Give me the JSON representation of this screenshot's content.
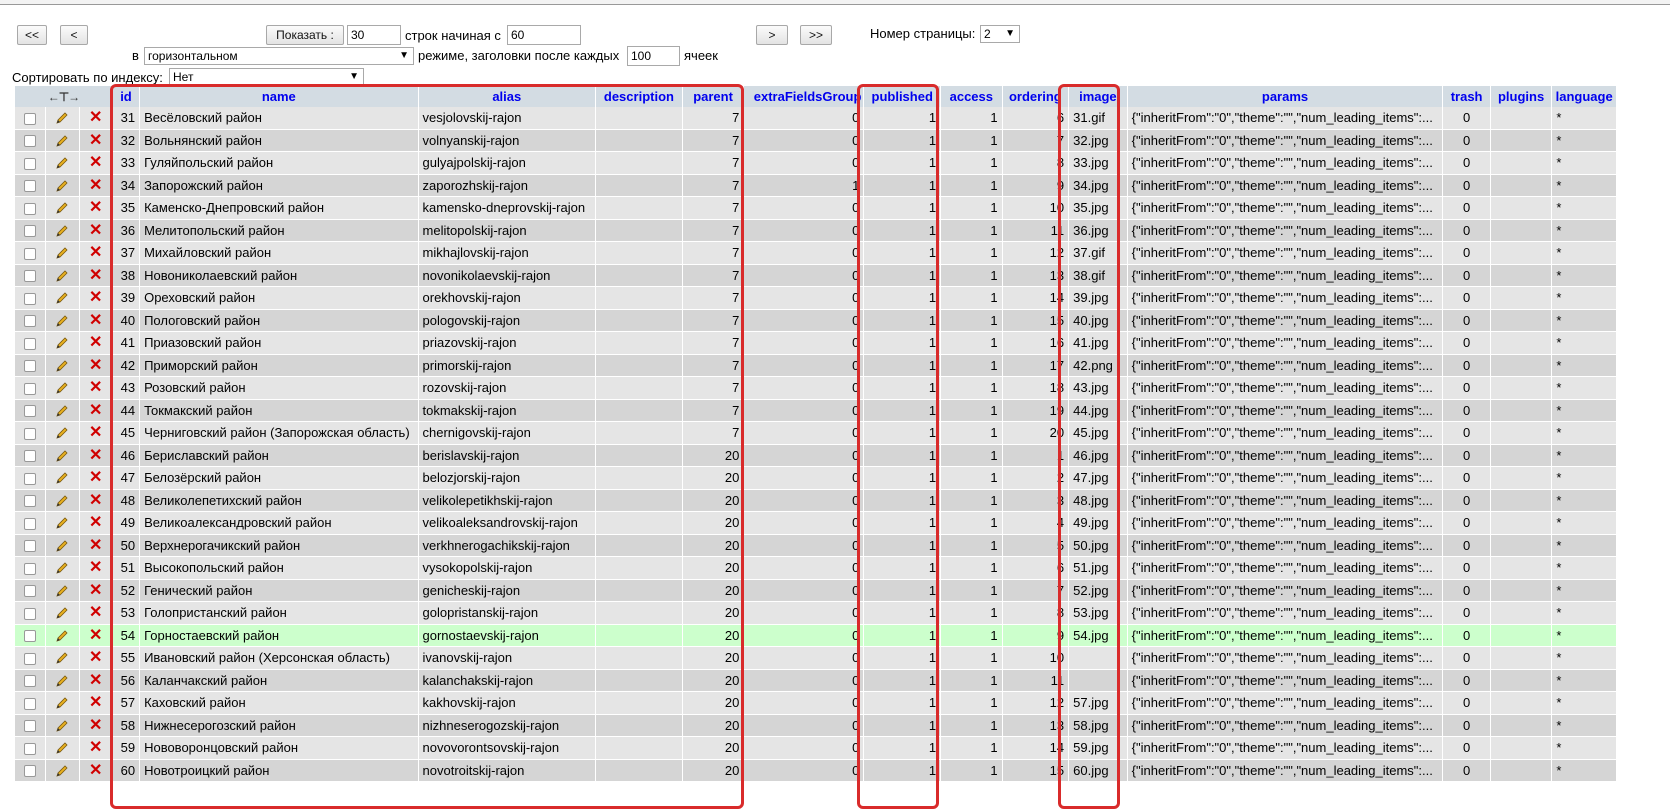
{
  "nav": {
    "first": "<<",
    "prev": "<",
    "show": "Показать :",
    "rows_value": "30",
    "rows_label": "строк начиная с",
    "start_value": "60",
    "next": ">",
    "last": ">>",
    "page_label": "Номер страницы:",
    "page_value": "2"
  },
  "mode": {
    "in_label": "в",
    "mode_value": "горизонтальном",
    "mode_label": "режиме, заголовки после каждых",
    "cells_value": "100",
    "cells_label": "ячеек"
  },
  "sort": {
    "label": "Сортировать по индексу:",
    "value": "Нет"
  },
  "columns": [
    "id",
    "name",
    "alias",
    "description",
    "parent",
    "extraFieldsGroup",
    "published",
    "access",
    "ordering",
    "image",
    "params",
    "trash",
    "plugins",
    "language"
  ],
  "params_text": "{\"inheritFrom\":\"0\",\"theme\":\"\",\"num_leading_items\":...",
  "rows": [
    {
      "id": "31",
      "name": "Весёловский район",
      "alias": "vesjolovskij-rajon",
      "parent": "7",
      "efg": "0",
      "published": "1",
      "access": "1",
      "ordering": "6",
      "image": "31.gif",
      "trash": "0",
      "language": "*"
    },
    {
      "id": "32",
      "name": "Вольнянский район",
      "alias": "volnyanskij-rajon",
      "parent": "7",
      "efg": "0",
      "published": "1",
      "access": "1",
      "ordering": "7",
      "image": "32.jpg",
      "trash": "0",
      "language": "*"
    },
    {
      "id": "33",
      "name": "Гуляйпольский район",
      "alias": "gulyajpolskij-rajon",
      "parent": "7",
      "efg": "0",
      "published": "1",
      "access": "1",
      "ordering": "8",
      "image": "33.jpg",
      "trash": "0",
      "language": "*"
    },
    {
      "id": "34",
      "name": "Запорожский район",
      "alias": "zaporozhskij-rajon",
      "parent": "7",
      "efg": "1",
      "published": "1",
      "access": "1",
      "ordering": "9",
      "image": "34.jpg",
      "trash": "0",
      "language": "*"
    },
    {
      "id": "35",
      "name": "Каменско-Днепровский район",
      "alias": "kamensko-dneprovskij-rajon",
      "parent": "7",
      "efg": "0",
      "published": "1",
      "access": "1",
      "ordering": "10",
      "image": "35.jpg",
      "trash": "0",
      "language": "*"
    },
    {
      "id": "36",
      "name": "Мелитопольский район",
      "alias": "melitopolskij-rajon",
      "parent": "7",
      "efg": "0",
      "published": "1",
      "access": "1",
      "ordering": "11",
      "image": "36.jpg",
      "trash": "0",
      "language": "*"
    },
    {
      "id": "37",
      "name": "Михайловский район",
      "alias": "mikhajlovskij-rajon",
      "parent": "7",
      "efg": "0",
      "published": "1",
      "access": "1",
      "ordering": "12",
      "image": "37.gif",
      "trash": "0",
      "language": "*"
    },
    {
      "id": "38",
      "name": "Новониколаевский район",
      "alias": "novonikolaevskij-rajon",
      "parent": "7",
      "efg": "0",
      "published": "1",
      "access": "1",
      "ordering": "13",
      "image": "38.gif",
      "trash": "0",
      "language": "*"
    },
    {
      "id": "39",
      "name": "Ореховский район",
      "alias": "orekhovskij-rajon",
      "parent": "7",
      "efg": "0",
      "published": "1",
      "access": "1",
      "ordering": "14",
      "image": "39.jpg",
      "trash": "0",
      "language": "*"
    },
    {
      "id": "40",
      "name": "Пологовский район",
      "alias": "pologovskij-rajon",
      "parent": "7",
      "efg": "0",
      "published": "1",
      "access": "1",
      "ordering": "15",
      "image": "40.jpg",
      "trash": "0",
      "language": "*"
    },
    {
      "id": "41",
      "name": "Приазовский район",
      "alias": "priazovskij-rajon",
      "parent": "7",
      "efg": "0",
      "published": "1",
      "access": "1",
      "ordering": "16",
      "image": "41.jpg",
      "trash": "0",
      "language": "*"
    },
    {
      "id": "42",
      "name": "Приморский район",
      "alias": "primorskij-rajon",
      "parent": "7",
      "efg": "0",
      "published": "1",
      "access": "1",
      "ordering": "17",
      "image": "42.png",
      "trash": "0",
      "language": "*"
    },
    {
      "id": "43",
      "name": "Розовский район",
      "alias": "rozovskij-rajon",
      "parent": "7",
      "efg": "0",
      "published": "1",
      "access": "1",
      "ordering": "18",
      "image": "43.jpg",
      "trash": "0",
      "language": "*"
    },
    {
      "id": "44",
      "name": "Токмакский район",
      "alias": "tokmakskij-rajon",
      "parent": "7",
      "efg": "0",
      "published": "1",
      "access": "1",
      "ordering": "19",
      "image": "44.jpg",
      "trash": "0",
      "language": "*"
    },
    {
      "id": "45",
      "name": "Черниговский район (Запорожская область)",
      "alias": "chernigovskij-rajon",
      "parent": "7",
      "efg": "0",
      "published": "1",
      "access": "1",
      "ordering": "20",
      "image": "45.jpg",
      "trash": "0",
      "language": "*"
    },
    {
      "id": "46",
      "name": "Бериславский район",
      "alias": "berislavskij-rajon",
      "parent": "20",
      "efg": "0",
      "published": "1",
      "access": "1",
      "ordering": "1",
      "image": "46.jpg",
      "trash": "0",
      "language": "*"
    },
    {
      "id": "47",
      "name": "Белозёрский район",
      "alias": "belozjorskij-rajon",
      "parent": "20",
      "efg": "0",
      "published": "1",
      "access": "1",
      "ordering": "2",
      "image": "47.jpg",
      "trash": "0",
      "language": "*"
    },
    {
      "id": "48",
      "name": "Великолепетихский район",
      "alias": "velikolepetikhskij-rajon",
      "parent": "20",
      "efg": "0",
      "published": "1",
      "access": "1",
      "ordering": "3",
      "image": "48.jpg",
      "trash": "0",
      "language": "*"
    },
    {
      "id": "49",
      "name": "Великоалександровский район",
      "alias": "velikoaleksandrovskij-rajon",
      "parent": "20",
      "efg": "0",
      "published": "1",
      "access": "1",
      "ordering": "4",
      "image": "49.jpg",
      "trash": "0",
      "language": "*"
    },
    {
      "id": "50",
      "name": "Верхнерогачикский район",
      "alias": "verkhnerogachikskij-rajon",
      "parent": "20",
      "efg": "0",
      "published": "1",
      "access": "1",
      "ordering": "5",
      "image": "50.jpg",
      "trash": "0",
      "language": "*"
    },
    {
      "id": "51",
      "name": "Высокопольский район",
      "alias": "vysokopolskij-rajon",
      "parent": "20",
      "efg": "0",
      "published": "1",
      "access": "1",
      "ordering": "6",
      "image": "51.jpg",
      "trash": "0",
      "language": "*"
    },
    {
      "id": "52",
      "name": "Генический район",
      "alias": "genicheskij-rajon",
      "parent": "20",
      "efg": "0",
      "published": "1",
      "access": "1",
      "ordering": "7",
      "image": "52.jpg",
      "trash": "0",
      "language": "*"
    },
    {
      "id": "53",
      "name": "Голопристанский район",
      "alias": "golopristanskij-rajon",
      "parent": "20",
      "efg": "0",
      "published": "1",
      "access": "1",
      "ordering": "8",
      "image": "53.jpg",
      "trash": "0",
      "language": "*"
    },
    {
      "id": "54",
      "name": "Горностаевский район",
      "alias": "gornostaevskij-rajon",
      "parent": "20",
      "efg": "0",
      "published": "1",
      "access": "1",
      "ordering": "9",
      "image": "54.jpg",
      "trash": "0",
      "language": "*",
      "highlight": true
    },
    {
      "id": "55",
      "name": "Ивановский район (Херсонская область)",
      "alias": "ivanovskij-rajon",
      "parent": "20",
      "efg": "0",
      "published": "1",
      "access": "1",
      "ordering": "10",
      "image": "",
      "trash": "0",
      "language": "*"
    },
    {
      "id": "56",
      "name": "Каланчакский район",
      "alias": "kalanchakskij-rajon",
      "parent": "20",
      "efg": "0",
      "published": "1",
      "access": "1",
      "ordering": "11",
      "image": "",
      "trash": "0",
      "language": "*"
    },
    {
      "id": "57",
      "name": "Каховский район",
      "alias": "kakhovskij-rajon",
      "parent": "20",
      "efg": "0",
      "published": "1",
      "access": "1",
      "ordering": "12",
      "image": "57.jpg",
      "trash": "0",
      "language": "*"
    },
    {
      "id": "58",
      "name": "Нижнесерогозский район",
      "alias": "nizhneserogozskij-rajon",
      "parent": "20",
      "efg": "0",
      "published": "1",
      "access": "1",
      "ordering": "13",
      "image": "58.jpg",
      "trash": "0",
      "language": "*"
    },
    {
      "id": "59",
      "name": "Нововоронцовский район",
      "alias": "novovorontsovskij-rajon",
      "parent": "20",
      "efg": "0",
      "published": "1",
      "access": "1",
      "ordering": "14",
      "image": "59.jpg",
      "trash": "0",
      "language": "*"
    },
    {
      "id": "60",
      "name": "Новотроицкий район",
      "alias": "novotroitskij-rajon",
      "parent": "20",
      "efg": "0",
      "published": "1",
      "access": "1",
      "ordering": "15",
      "image": "60.jpg",
      "trash": "0",
      "language": "*"
    }
  ],
  "colors": {
    "header_bg": "#d3dce3",
    "row_odd": "#e5e5e5",
    "row_even": "#d5d5d5",
    "row_highlight": "#ccffcc",
    "link": "#0000ee",
    "annotation": "#d92b2b",
    "delete": "#d00000"
  }
}
